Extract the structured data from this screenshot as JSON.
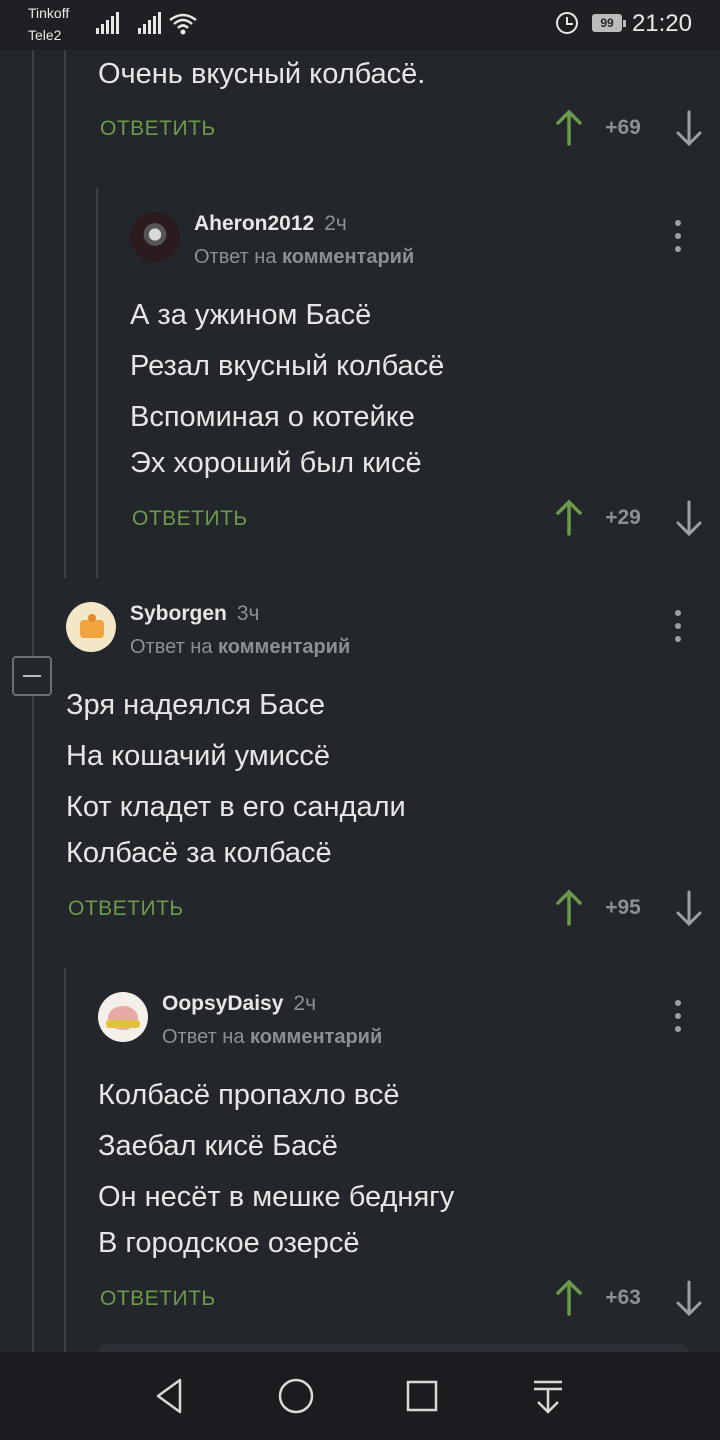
{
  "status_bar": {
    "carrier1": "Tinkoff",
    "carrier2": "Tele2",
    "battery": "99",
    "time": "21:20"
  },
  "comments": [
    {
      "lines": [
        "Очень вкусный колбасё."
      ],
      "reply_label": "ОТВЕТИТЬ",
      "score": "+69"
    },
    {
      "author": "Aheron2012",
      "ago": "2ч",
      "reply_to_prefix": "Ответ на",
      "reply_to_target": "комментарий",
      "lines": [
        "А за ужином Басё",
        "Резал вкусный колбасё",
        "Вспоминая о котейке",
        "Эх хороший был кисё"
      ],
      "reply_label": "ОТВЕТИТЬ",
      "score": "+29"
    },
    {
      "author": "Syborgen",
      "ago": "3ч",
      "reply_to_prefix": "Ответ на",
      "reply_to_target": "комментарий",
      "lines": [
        "Зря надеялся Басе",
        "На кошачий умиссё",
        "Кот кладет в его сандали",
        "Колбасё за колбасё"
      ],
      "reply_label": "ОТВЕТИТЬ",
      "score": "+95"
    },
    {
      "author": "OopsyDaisy",
      "ago": "2ч",
      "reply_to_prefix": "Ответ на",
      "reply_to_target": "комментарий",
      "lines": [
        "Колбасё пропахло всё",
        "Заебал кисё Басё",
        "Он несёт в мешке беднягу",
        "В городское озерсё"
      ],
      "reply_label": "ОТВЕТИТЬ",
      "score": "+63"
    }
  ],
  "colors": {
    "background": "#23262b",
    "reply_green": "#6b9a4c",
    "upvote_green": "#6b9a4c",
    "muted": "#8c9096"
  },
  "icons": [
    "alarm-icon",
    "upvote-icon",
    "downvote-icon",
    "more-icon",
    "collapse-icon",
    "back-icon",
    "home-icon",
    "recents-icon",
    "notifications-icon"
  ]
}
